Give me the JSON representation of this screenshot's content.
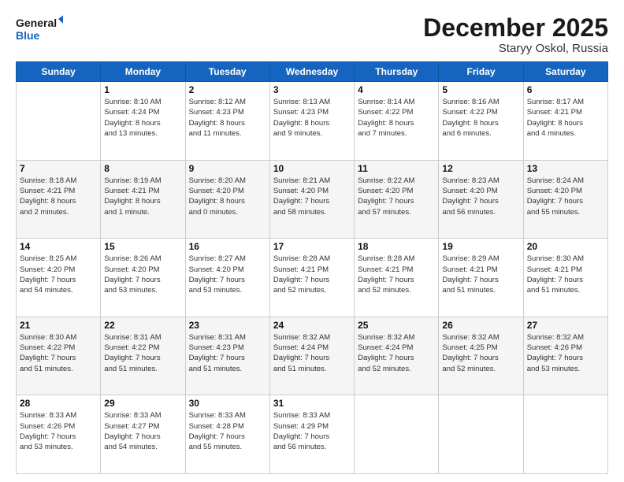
{
  "header": {
    "logo_line1": "General",
    "logo_line2": "Blue",
    "month": "December 2025",
    "location": "Staryy Oskol, Russia"
  },
  "days_of_week": [
    "Sunday",
    "Monday",
    "Tuesday",
    "Wednesday",
    "Thursday",
    "Friday",
    "Saturday"
  ],
  "weeks": [
    [
      {
        "day": "",
        "info": ""
      },
      {
        "day": "1",
        "info": "Sunrise: 8:10 AM\nSunset: 4:24 PM\nDaylight: 8 hours\nand 13 minutes."
      },
      {
        "day": "2",
        "info": "Sunrise: 8:12 AM\nSunset: 4:23 PM\nDaylight: 8 hours\nand 11 minutes."
      },
      {
        "day": "3",
        "info": "Sunrise: 8:13 AM\nSunset: 4:23 PM\nDaylight: 8 hours\nand 9 minutes."
      },
      {
        "day": "4",
        "info": "Sunrise: 8:14 AM\nSunset: 4:22 PM\nDaylight: 8 hours\nand 7 minutes."
      },
      {
        "day": "5",
        "info": "Sunrise: 8:16 AM\nSunset: 4:22 PM\nDaylight: 8 hours\nand 6 minutes."
      },
      {
        "day": "6",
        "info": "Sunrise: 8:17 AM\nSunset: 4:21 PM\nDaylight: 8 hours\nand 4 minutes."
      }
    ],
    [
      {
        "day": "7",
        "info": "Sunrise: 8:18 AM\nSunset: 4:21 PM\nDaylight: 8 hours\nand 2 minutes."
      },
      {
        "day": "8",
        "info": "Sunrise: 8:19 AM\nSunset: 4:21 PM\nDaylight: 8 hours\nand 1 minute."
      },
      {
        "day": "9",
        "info": "Sunrise: 8:20 AM\nSunset: 4:20 PM\nDaylight: 8 hours\nand 0 minutes."
      },
      {
        "day": "10",
        "info": "Sunrise: 8:21 AM\nSunset: 4:20 PM\nDaylight: 7 hours\nand 58 minutes."
      },
      {
        "day": "11",
        "info": "Sunrise: 8:22 AM\nSunset: 4:20 PM\nDaylight: 7 hours\nand 57 minutes."
      },
      {
        "day": "12",
        "info": "Sunrise: 8:23 AM\nSunset: 4:20 PM\nDaylight: 7 hours\nand 56 minutes."
      },
      {
        "day": "13",
        "info": "Sunrise: 8:24 AM\nSunset: 4:20 PM\nDaylight: 7 hours\nand 55 minutes."
      }
    ],
    [
      {
        "day": "14",
        "info": "Sunrise: 8:25 AM\nSunset: 4:20 PM\nDaylight: 7 hours\nand 54 minutes."
      },
      {
        "day": "15",
        "info": "Sunrise: 8:26 AM\nSunset: 4:20 PM\nDaylight: 7 hours\nand 53 minutes."
      },
      {
        "day": "16",
        "info": "Sunrise: 8:27 AM\nSunset: 4:20 PM\nDaylight: 7 hours\nand 53 minutes."
      },
      {
        "day": "17",
        "info": "Sunrise: 8:28 AM\nSunset: 4:21 PM\nDaylight: 7 hours\nand 52 minutes."
      },
      {
        "day": "18",
        "info": "Sunrise: 8:28 AM\nSunset: 4:21 PM\nDaylight: 7 hours\nand 52 minutes."
      },
      {
        "day": "19",
        "info": "Sunrise: 8:29 AM\nSunset: 4:21 PM\nDaylight: 7 hours\nand 51 minutes."
      },
      {
        "day": "20",
        "info": "Sunrise: 8:30 AM\nSunset: 4:21 PM\nDaylight: 7 hours\nand 51 minutes."
      }
    ],
    [
      {
        "day": "21",
        "info": "Sunrise: 8:30 AM\nSunset: 4:22 PM\nDaylight: 7 hours\nand 51 minutes."
      },
      {
        "day": "22",
        "info": "Sunrise: 8:31 AM\nSunset: 4:22 PM\nDaylight: 7 hours\nand 51 minutes."
      },
      {
        "day": "23",
        "info": "Sunrise: 8:31 AM\nSunset: 4:23 PM\nDaylight: 7 hours\nand 51 minutes."
      },
      {
        "day": "24",
        "info": "Sunrise: 8:32 AM\nSunset: 4:24 PM\nDaylight: 7 hours\nand 51 minutes."
      },
      {
        "day": "25",
        "info": "Sunrise: 8:32 AM\nSunset: 4:24 PM\nDaylight: 7 hours\nand 52 minutes."
      },
      {
        "day": "26",
        "info": "Sunrise: 8:32 AM\nSunset: 4:25 PM\nDaylight: 7 hours\nand 52 minutes."
      },
      {
        "day": "27",
        "info": "Sunrise: 8:32 AM\nSunset: 4:26 PM\nDaylight: 7 hours\nand 53 minutes."
      }
    ],
    [
      {
        "day": "28",
        "info": "Sunrise: 8:33 AM\nSunset: 4:26 PM\nDaylight: 7 hours\nand 53 minutes."
      },
      {
        "day": "29",
        "info": "Sunrise: 8:33 AM\nSunset: 4:27 PM\nDaylight: 7 hours\nand 54 minutes."
      },
      {
        "day": "30",
        "info": "Sunrise: 8:33 AM\nSunset: 4:28 PM\nDaylight: 7 hours\nand 55 minutes."
      },
      {
        "day": "31",
        "info": "Sunrise: 8:33 AM\nSunset: 4:29 PM\nDaylight: 7 hours\nand 56 minutes."
      },
      {
        "day": "",
        "info": ""
      },
      {
        "day": "",
        "info": ""
      },
      {
        "day": "",
        "info": ""
      }
    ]
  ]
}
